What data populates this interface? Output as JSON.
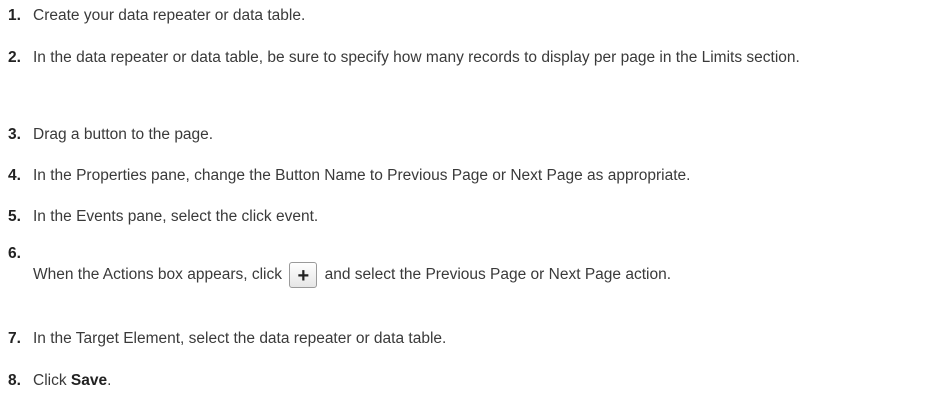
{
  "steps": [
    {
      "num": "1.",
      "text": "Create your data repeater or data table."
    },
    {
      "num": "2.",
      "text": "In the data repeater or data table, be sure to specify how many records to display per page in the Limits section."
    },
    {
      "num": "3.",
      "text": "Drag a button to the page."
    },
    {
      "num": "4.",
      "text": "In the Properties pane, change the Button Name to Previous Page or Next Page as appropriate."
    },
    {
      "num": "5.",
      "text": "In the Events pane, select the click event."
    },
    {
      "num": "6.",
      "text_before": "When the Actions box appears, click",
      "button_glyph": "+",
      "button_icon": "plus-icon",
      "text_after": "and select the Previous Page or Next Page action."
    },
    {
      "num": "7.",
      "text": "In the Target Element, select the data repeater or data table."
    },
    {
      "num": "8.",
      "text_before": "Click ",
      "bold": "Save",
      "text_after": "."
    }
  ]
}
